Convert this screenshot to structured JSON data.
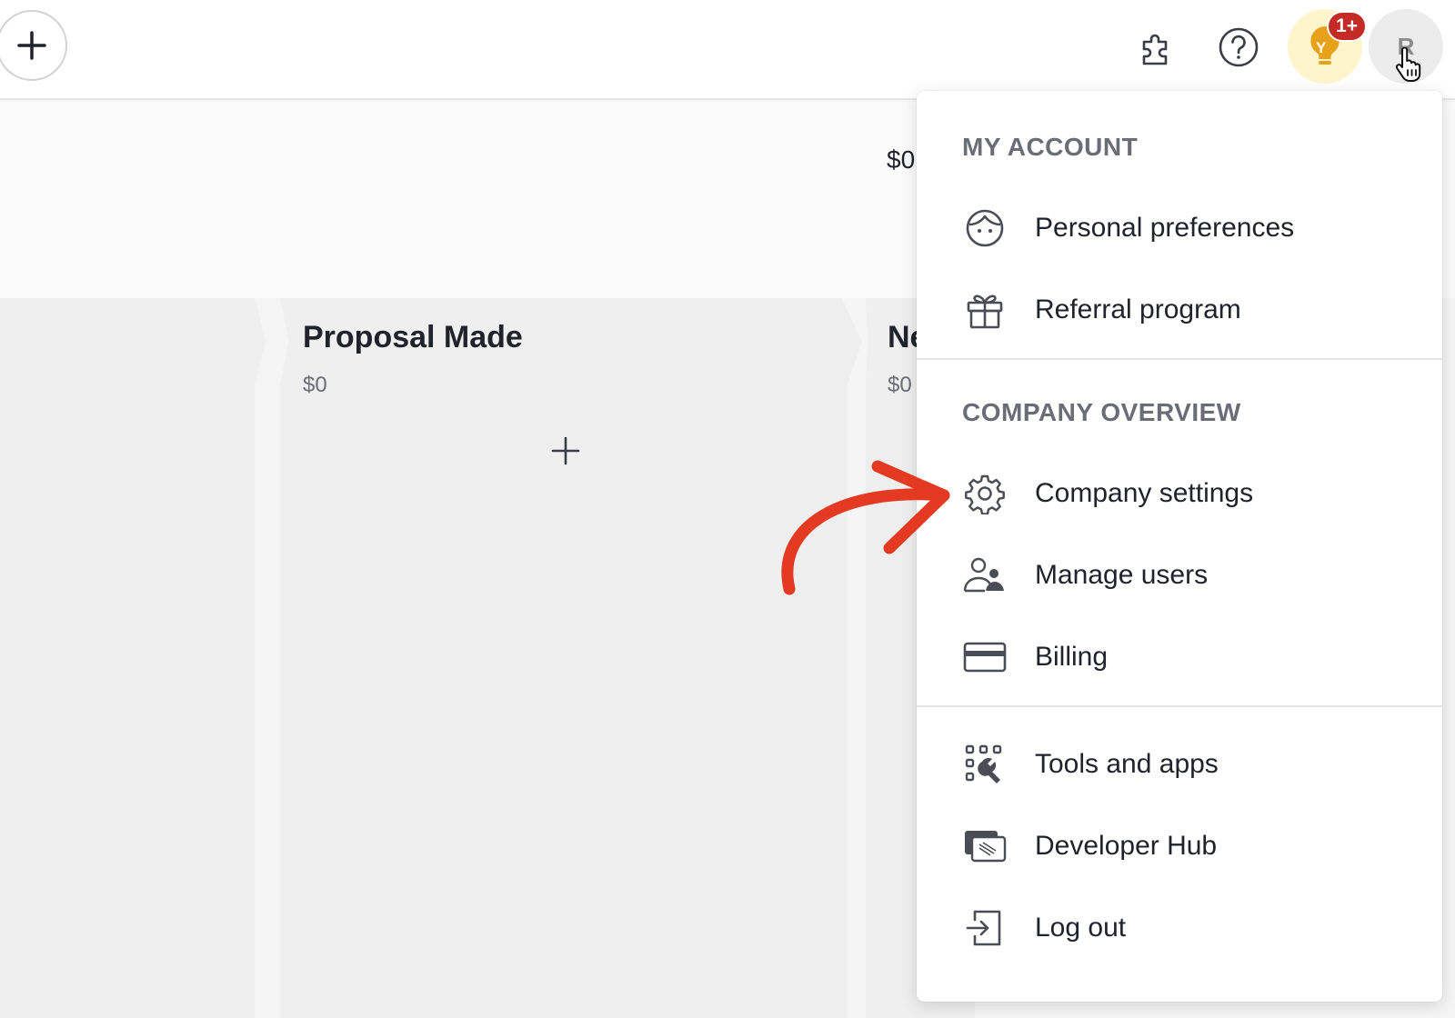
{
  "topbar": {
    "add_icon": "plus-icon",
    "extensions_icon": "puzzle-icon",
    "help_icon": "question-circle-icon",
    "bulb_letter": "Y",
    "notifications_badge": "1+",
    "avatar_initial": "R"
  },
  "pipeline": {
    "summary_value": "$0",
    "columns": [
      {
        "title": "",
        "value": ""
      },
      {
        "title": "Proposal Made",
        "value": "$0"
      },
      {
        "title": "Ne",
        "value": "$0"
      }
    ]
  },
  "menu": {
    "my_account": {
      "title": "MY ACCOUNT",
      "items": [
        {
          "label": "Personal preferences",
          "icon": "face-icon"
        },
        {
          "label": "Referral program",
          "icon": "gift-icon"
        }
      ]
    },
    "company_overview": {
      "title": "COMPANY OVERVIEW",
      "items": [
        {
          "label": "Company settings",
          "icon": "gear-icon"
        },
        {
          "label": "Manage users",
          "icon": "users-icon"
        },
        {
          "label": "Billing",
          "icon": "credit-card-icon"
        }
      ]
    },
    "other": {
      "items": [
        {
          "label": "Tools and apps",
          "icon": "tools-icon"
        },
        {
          "label": "Developer Hub",
          "icon": "developer-hub-icon"
        },
        {
          "label": "Log out",
          "icon": "logout-icon"
        }
      ]
    }
  },
  "colors": {
    "annotation_arrow": "#e53a22",
    "badge": "#c42b27",
    "bulb": "#e8a21a"
  }
}
